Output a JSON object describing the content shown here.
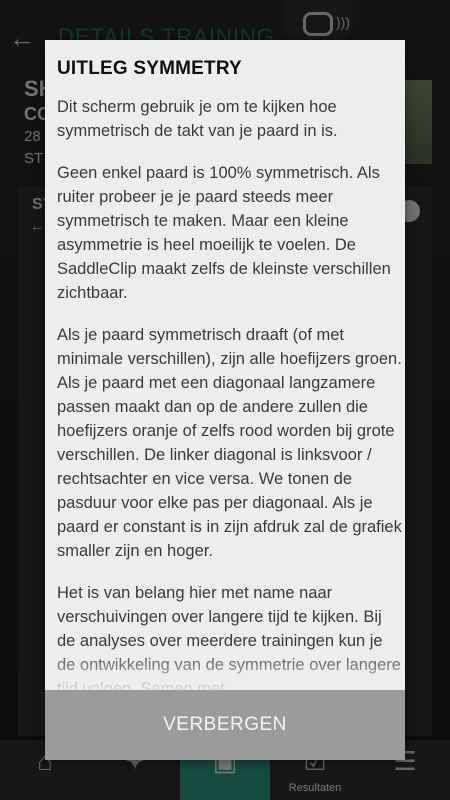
{
  "app": {
    "header_title": "DETAILS TRAINING",
    "horse_name": "SH",
    "horse_sub": "CO",
    "date": "28",
    "start": "ST",
    "panel_label": "SY"
  },
  "tabbar": {
    "tabs": [
      {
        "icon": "home-icon",
        "label": ""
      },
      {
        "icon": "horse-icon",
        "label": ""
      },
      {
        "icon": "saddleclip-icon",
        "label": "",
        "active": true
      },
      {
        "icon": "results-icon",
        "label": "Resultaten"
      },
      {
        "icon": "menu-icon",
        "label": ""
      }
    ]
  },
  "modal": {
    "title": "UITLEG SYMMETRY",
    "paragraphs": [
      "Dit scherm gebruik je om te kijken hoe symmetrisch de takt van je paard in is.",
      "Geen enkel paard is 100% symmetrisch. Als ruiter probeer je je paard steeds meer symmetrisch te maken. Maar een kleine asymmetrie is heel moeilijk te voelen. De SaddleClip maakt zelfs de kleinste verschillen zichtbaar.",
      "Als je paard symmetrisch draaft (of met minimale verschillen), zijn alle hoefijzers groen. Als je paard met een diagonaal langzamere passen maakt dan op de andere zullen die hoefijzers oranje of zelfs rood worden bij grote verschillen. De linker diagonal is linksvoor / rechtsachter en vice versa. We tonen de pasduur voor elke pas per diagonaal. Als je paard er constant is in zijn afdruk zal de grafiek smaller zijn en hoger.",
      "Het is van belang hier met name naar verschuivingen over langere tijd te kijken. Bij de analyses over meerdere trainingen kun je de ontwikkeling van de symmetrie over langere tijd volgen. Samen met"
    ],
    "button_label": "VERBERGEN"
  },
  "colors": {
    "accent": "#2a8a7a",
    "modal_bg": "#ededed",
    "button_bg": "#9b9b9b"
  }
}
